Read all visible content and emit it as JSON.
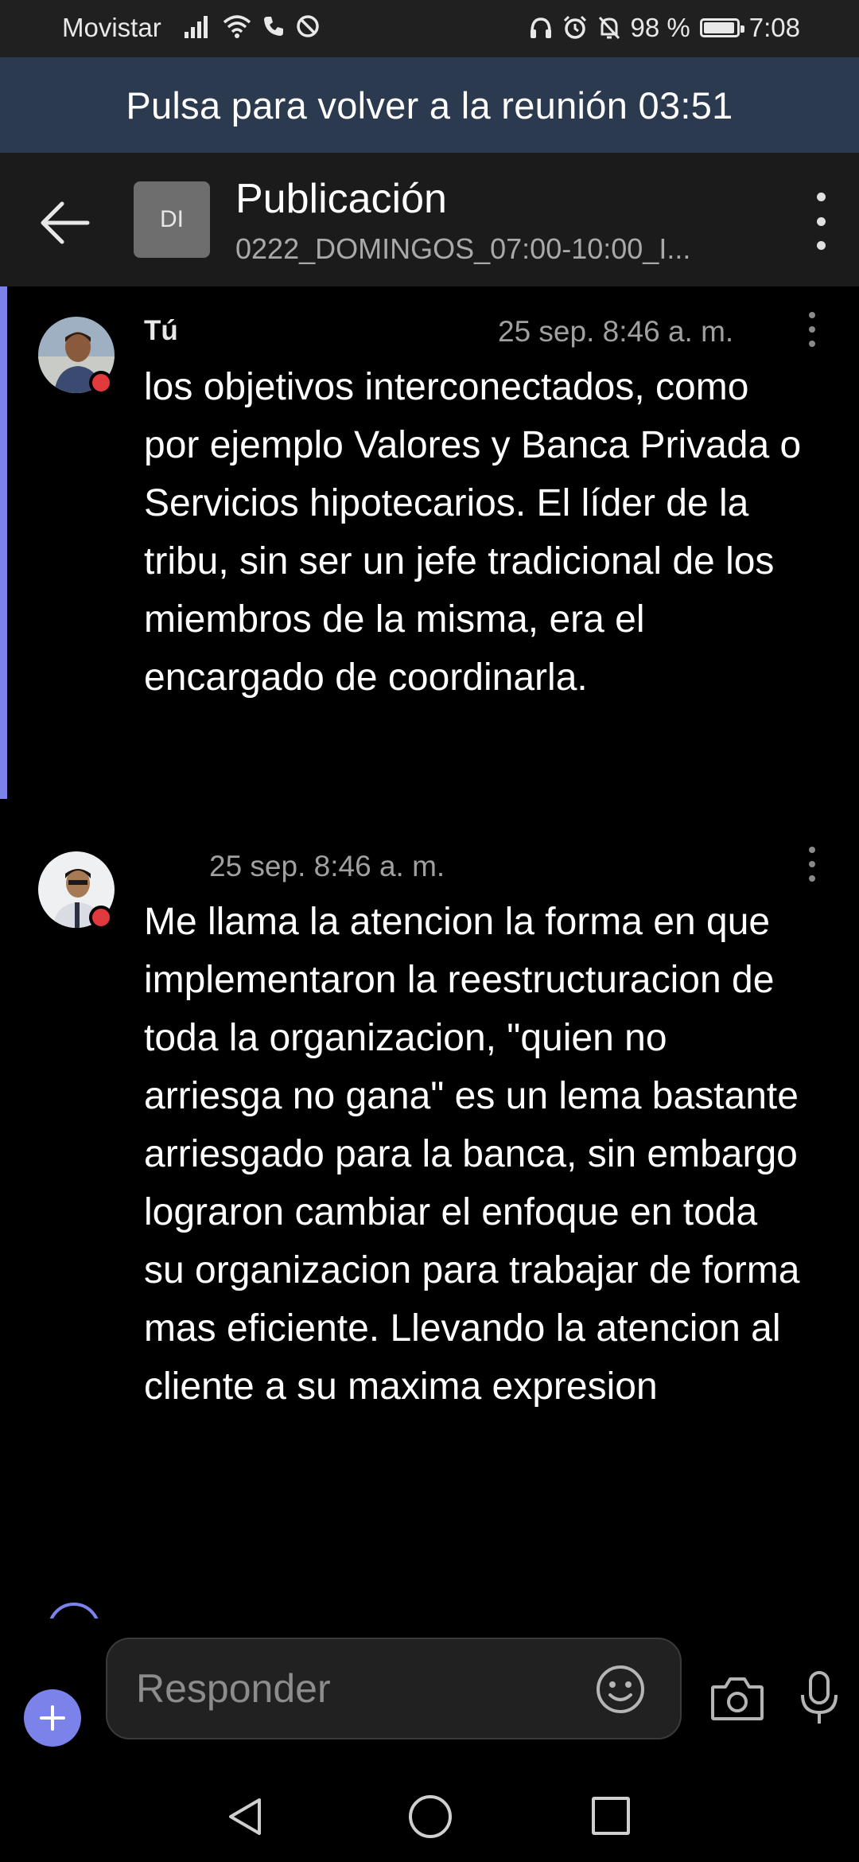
{
  "status_bar": {
    "carrier": "Movistar",
    "battery_text": "98 %",
    "battery_level": 0.98,
    "time": "7:08"
  },
  "meeting_banner": {
    "text": "Pulsa para volver a la reunión 03:51"
  },
  "header": {
    "avatar_initials": "DI",
    "title": "Publicación",
    "subtitle": "0222_DOMINGOS_07:00-10:00_I..."
  },
  "messages": [
    {
      "author": "Tú",
      "timestamp": "25 sep. 8:46 a. m.",
      "text": "los objetivos interconectados, como por ejemplo Valores y Banca Privada o Servicios hipotecarios. El líder de la tribu, sin ser un jefe tradicional de los miembros de la misma, era el encargado de coordinarla."
    },
    {
      "author": "",
      "timestamp": "25 sep. 8:46 a. m.",
      "text": "Me llama la atencion la forma en que implementaron la reestructuracion de toda la organizacion, \"quien no arriesga no gana\" es un lema bastante arriesgado para la banca, sin embargo lograron cambiar el enfoque en toda su organizacion para trabajar de forma mas eficiente. Llevando la atencion al cliente a su maxima expresion"
    }
  ],
  "compose": {
    "placeholder": "Responder"
  },
  "icons": {
    "back": "arrow-left-icon",
    "more": "more-vertical-icon",
    "add": "plus-icon",
    "emoji": "emoji-icon",
    "camera": "camera-icon",
    "mic": "microphone-icon"
  },
  "colors": {
    "accent": "#7b83eb",
    "banner": "#2b3a4f",
    "presence_busy": "#e03a3e"
  }
}
